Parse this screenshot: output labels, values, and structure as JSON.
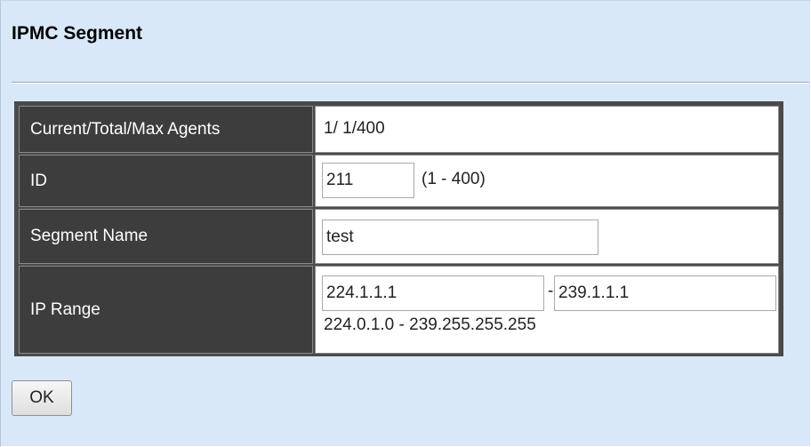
{
  "page": {
    "title": "IPMC Segment"
  },
  "form": {
    "agents": {
      "label": "Current/Total/Max Agents",
      "value": "1/ 1/400"
    },
    "id": {
      "label": "ID",
      "value": "211",
      "hint": "(1 - 400)"
    },
    "segment_name": {
      "label": "Segment Name",
      "value": "test"
    },
    "ip_range": {
      "label": "IP Range",
      "start_value": "224.1.1.1",
      "separator": "-",
      "end_value": "239.1.1.1",
      "hint": "224.0.1.0 - 239.255.255.255"
    }
  },
  "actions": {
    "ok_label": "OK"
  },
  "colors": {
    "panel_background": "#d9e8f8",
    "label_background": "#3d3d3d",
    "table_border": "#4a4a4a"
  }
}
